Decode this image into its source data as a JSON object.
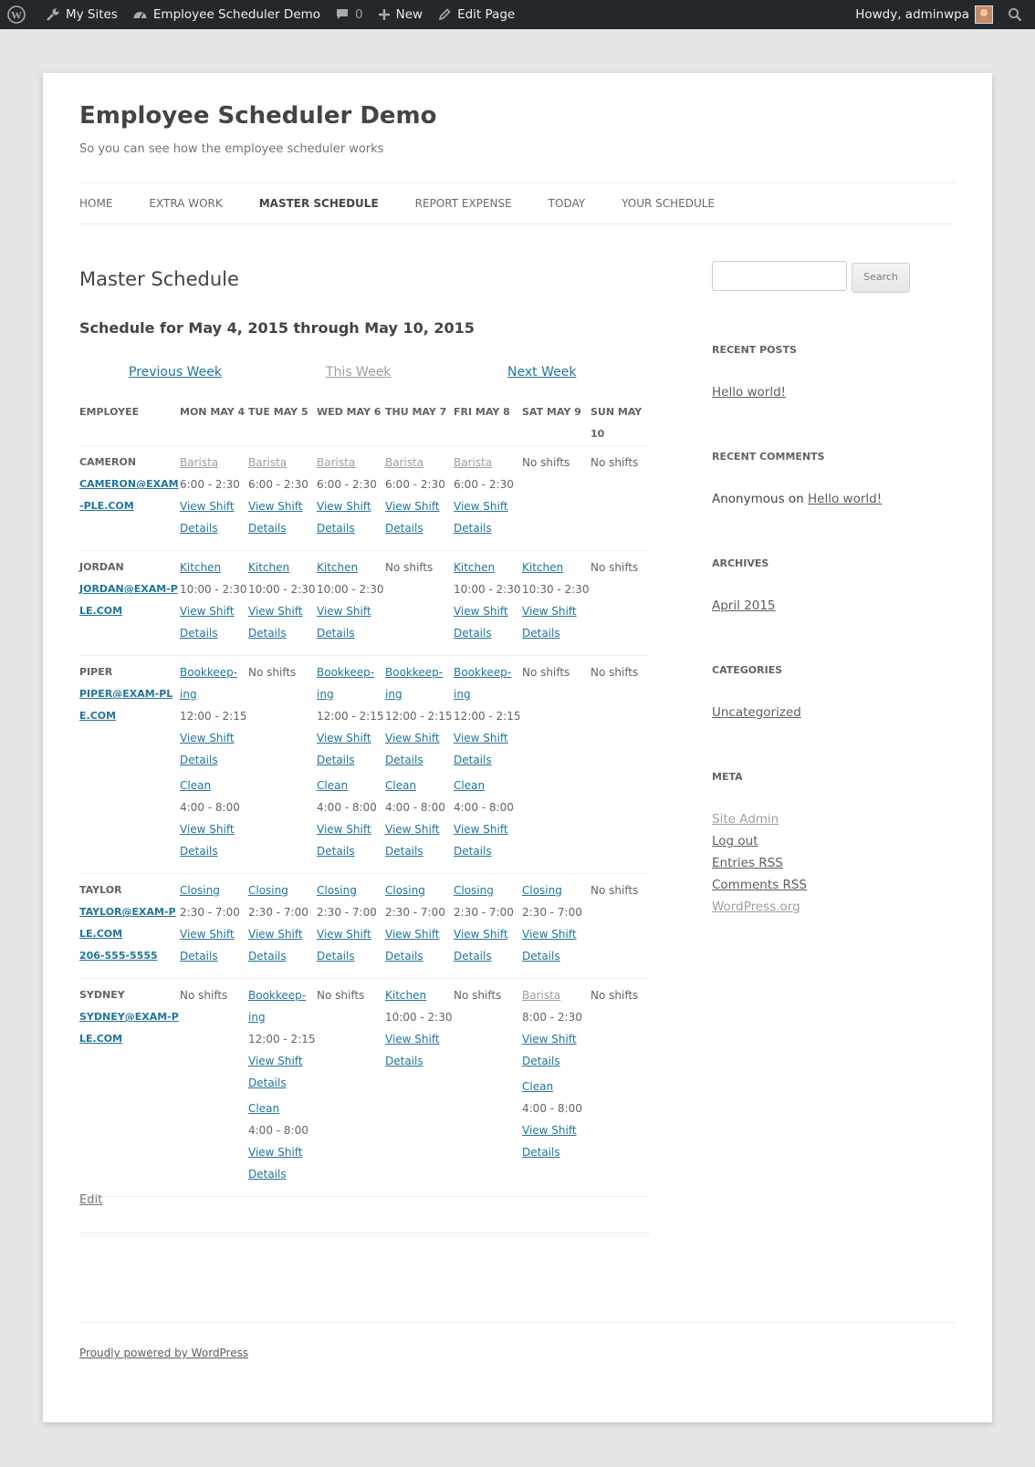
{
  "admin_bar": {
    "my_sites": "My Sites",
    "site_name": "Employee Scheduler Demo",
    "comments_count": "0",
    "new_label": "New",
    "edit_page": "Edit Page",
    "howdy": "Howdy, adminwpa"
  },
  "site": {
    "title": "Employee Scheduler Demo",
    "description": "So you can see how the employee scheduler works"
  },
  "nav": {
    "items": [
      "HOME",
      "EXTRA WORK",
      "MASTER SCHEDULE",
      "REPORT EXPENSE",
      "TODAY",
      "YOUR SCHEDULE"
    ],
    "current": "MASTER SCHEDULE"
  },
  "content": {
    "title": "Master Schedule",
    "schedule_heading": "Schedule for May 4, 2015 through May 10, 2015",
    "prev_week": "Previous Week",
    "this_week": "This Week",
    "next_week": "Next Week",
    "edit": "Edit"
  },
  "schedule": {
    "headers": [
      "EMPLOYEE",
      "MON MAY 4",
      "TUE MAY 5",
      "WED MAY 6",
      "THU MAY 7",
      "FRI MAY 8",
      "SAT MAY 9",
      "SUN MAY 10"
    ],
    "view_shift_label": "View Shift",
    "details_label": "Details",
    "no_shifts_label": "No shifts",
    "rows": [
      {
        "name": "CAMERON",
        "email": "CAMERON@EXAM-PLE.COM",
        "phone": "",
        "days": [
          [
            {
              "job": "Barista",
              "time": "6:00 - 2:30",
              "past": true
            }
          ],
          [
            {
              "job": "Barista",
              "time": "6:00 - 2:30",
              "past": true
            }
          ],
          [
            {
              "job": "Barista",
              "time": "6:00 - 2:30",
              "past": true
            }
          ],
          [
            {
              "job": "Barista",
              "time": "6:00 - 2:30",
              "past": true
            }
          ],
          [
            {
              "job": "Barista",
              "time": "6:00 - 2:30",
              "past": true
            }
          ],
          [],
          []
        ]
      },
      {
        "name": "JORDAN",
        "email": "JORDAN@EXAM-PLE.COM",
        "phone": "",
        "days": [
          [
            {
              "job": "Kitchen",
              "time": "10:00 - 2:30",
              "past": false
            }
          ],
          [
            {
              "job": "Kitchen",
              "time": "10:00 - 2:30",
              "past": false
            }
          ],
          [
            {
              "job": "Kitchen",
              "time": "10:00 - 2:30",
              "past": false
            }
          ],
          [],
          [
            {
              "job": "Kitchen",
              "time": "10:00 - 2:30",
              "past": false
            }
          ],
          [
            {
              "job": "Kitchen",
              "time": "10:30 - 2:30",
              "past": false
            }
          ],
          []
        ]
      },
      {
        "name": "PIPER",
        "email": "PIPER@EXAM-PLE.COM",
        "phone": "",
        "days": [
          [
            {
              "job": "Bookkeep-ing",
              "time": "12:00 - 2:15",
              "past": false
            },
            {
              "job": "Clean",
              "time": "4:00 - 8:00",
              "past": false
            }
          ],
          [],
          [
            {
              "job": "Bookkeep-ing",
              "time": "12:00 - 2:15",
              "past": false
            },
            {
              "job": "Clean",
              "time": "4:00 - 8:00",
              "past": false
            }
          ],
          [
            {
              "job": "Bookkeep-ing",
              "time": "12:00 - 2:15",
              "past": false
            },
            {
              "job": "Clean",
              "time": "4:00 - 8:00",
              "past": false
            }
          ],
          [
            {
              "job": "Bookkeep-ing",
              "time": "12:00 - 2:15",
              "past": false
            },
            {
              "job": "Clean",
              "time": "4:00 - 8:00",
              "past": false
            }
          ],
          [],
          []
        ]
      },
      {
        "name": "TAYLOR",
        "email": "TAYLOR@EXAM-PLE.COM",
        "phone": "206-555-5555",
        "days": [
          [
            {
              "job": "Closing",
              "time": "2:30 - 7:00",
              "past": false
            }
          ],
          [
            {
              "job": "Closing",
              "time": "2:30 - 7:00",
              "past": false
            }
          ],
          [
            {
              "job": "Closing",
              "time": "2:30 - 7:00",
              "past": false
            }
          ],
          [
            {
              "job": "Closing",
              "time": "2:30 - 7:00",
              "past": false
            }
          ],
          [
            {
              "job": "Closing",
              "time": "2:30 - 7:00",
              "past": false
            }
          ],
          [
            {
              "job": "Closing",
              "time": "2:30 - 7:00",
              "past": false
            }
          ],
          []
        ]
      },
      {
        "name": "SYDNEY",
        "email": "SYDNEY@EXAM-PLE.COM",
        "phone": "",
        "days": [
          [],
          [
            {
              "job": "Bookkeep-ing",
              "time": "12:00 - 2:15",
              "past": false
            },
            {
              "job": "Clean",
              "time": "4:00 - 8:00",
              "past": false
            }
          ],
          [],
          [
            {
              "job": "Kitchen",
              "time": "10:00 - 2:30",
              "past": false
            }
          ],
          [],
          [
            {
              "job": "Barista",
              "time": "8:00 - 2:30",
              "past": true
            },
            {
              "job": "Clean",
              "time": "4:00 - 8:00",
              "past": false
            }
          ],
          []
        ]
      }
    ]
  },
  "sidebar": {
    "search_button": "Search",
    "recent_posts_title": "RECENT POSTS",
    "recent_post": "Hello world!",
    "recent_comments_title": "RECENT COMMENTS",
    "comment_author": "Anonymous",
    "comment_on": "on",
    "comment_post": "Hello world!",
    "archives_title": "ARCHIVES",
    "archive_item": "April 2015",
    "categories_title": "CATEGORIES",
    "category_item": "Uncategorized",
    "meta_title": "META",
    "meta_items": [
      "Site Admin",
      "Log out",
      "Entries RSS",
      "Comments RSS",
      "WordPress.org"
    ]
  },
  "footer": {
    "powered": "Proudly powered by WordPress"
  },
  "colors": {
    "admin_bar": "#23282d",
    "link": "#21759b",
    "page_bg": "#e6e6e6"
  }
}
